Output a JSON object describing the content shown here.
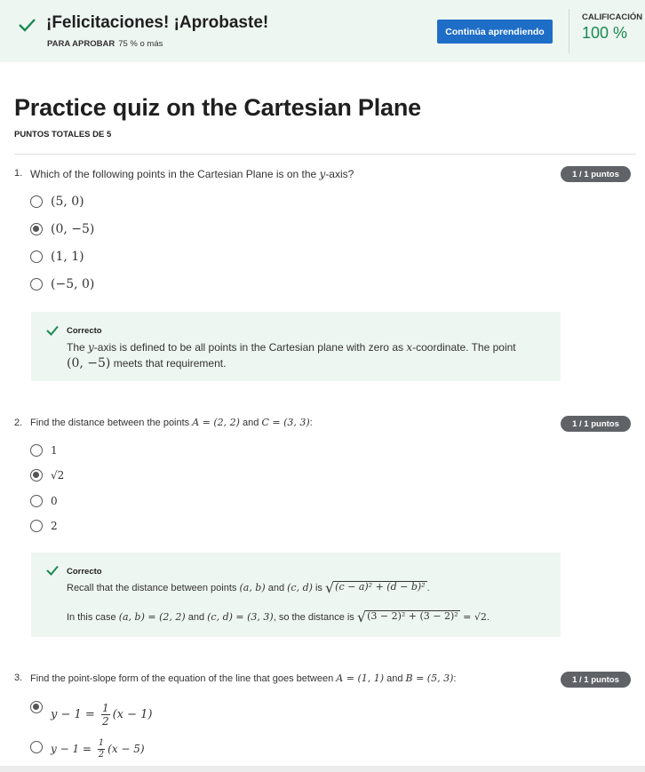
{
  "banner": {
    "title": "¡Felicitaciones! ¡Aprobaste!",
    "pass_label": "PARA APROBAR",
    "pass_value": "75 % o más",
    "continue_button": "Continúa aprendiendo",
    "grade_label": "CALIFICACIÓN",
    "grade_value": "100 %"
  },
  "quiz": {
    "title": "Practice quiz on the Cartesian Plane",
    "total_points": "PUNTOS TOTALES DE 5"
  },
  "questions": [
    {
      "number": "1.",
      "text_pre": "Which of the following points in the Cartesian Plane is on the ",
      "text_var": "y",
      "text_post": "-axis?",
      "points": "1 / 1 puntos",
      "options": [
        "(5, 0)",
        "(0, −5)",
        "(1, 1)",
        "(−5, 0)"
      ],
      "selected_index": 1,
      "feedback_title": "Correcto",
      "feedback_l1_a": "The ",
      "feedback_l1_var": "y",
      "feedback_l1_b": "-axis is defined to be all points in the Cartesian plane with zero as ",
      "feedback_l1_var2": "x",
      "feedback_l1_c": "-coordinate. The point",
      "feedback_l2_math": "(0, −5)",
      "feedback_l2_text": " meets that requirement."
    },
    {
      "number": "2.",
      "text_pre": "Find the distance between the points ",
      "text_m1": "A = (2, 2)",
      "text_mid": " and ",
      "text_m2": "C = (3, 3)",
      "text_post": ":",
      "points": "1 / 1 puntos",
      "options": [
        "1",
        "√2",
        "0",
        "2"
      ],
      "selected_index": 1,
      "feedback_title": "Correcto",
      "feedback_l1_a": "Recall that the distance between points ",
      "feedback_l1_m1": "(a, b)",
      "feedback_l1_b": " and ",
      "feedback_l1_m2": "(c, d)",
      "feedback_l1_c": " is ",
      "feedback_l1_sqrt": "(c − a)² + (d − b)²",
      "feedback_l1_end": ".",
      "feedback_l2_a": "In this case ",
      "feedback_l2_m1": "(a, b) = (2, 2)",
      "feedback_l2_b": " and ",
      "feedback_l2_m2": "(c, d) = (3, 3)",
      "feedback_l2_c": ", so the distance is ",
      "feedback_l2_sqrt": "(3 − 2)² + (3 − 2)²",
      "feedback_l2_eq": " = √2",
      "feedback_l2_end": "."
    },
    {
      "number": "3.",
      "text_pre": "Find the point-slope form of the equation of the line that goes between ",
      "text_m1": "A = (1, 1)",
      "text_mid": " and ",
      "text_m2": "B = (5, 3)",
      "text_post": ":",
      "points": "1 / 1 puntos",
      "options": [
        {
          "lhs": "y − 1 = ",
          "num": "1",
          "den": "2",
          "rhs": "(x − 1)"
        },
        {
          "lhs": "y − 1 = ",
          "num": "1",
          "den": "2",
          "rhs": "(x − 5)"
        }
      ],
      "selected_index": 0
    }
  ],
  "colors": {
    "banner_bg": "#eef6f2",
    "accent_green": "#1a8a4f",
    "button_blue": "#1e6ec8",
    "badge_gray": "#5f6368"
  }
}
